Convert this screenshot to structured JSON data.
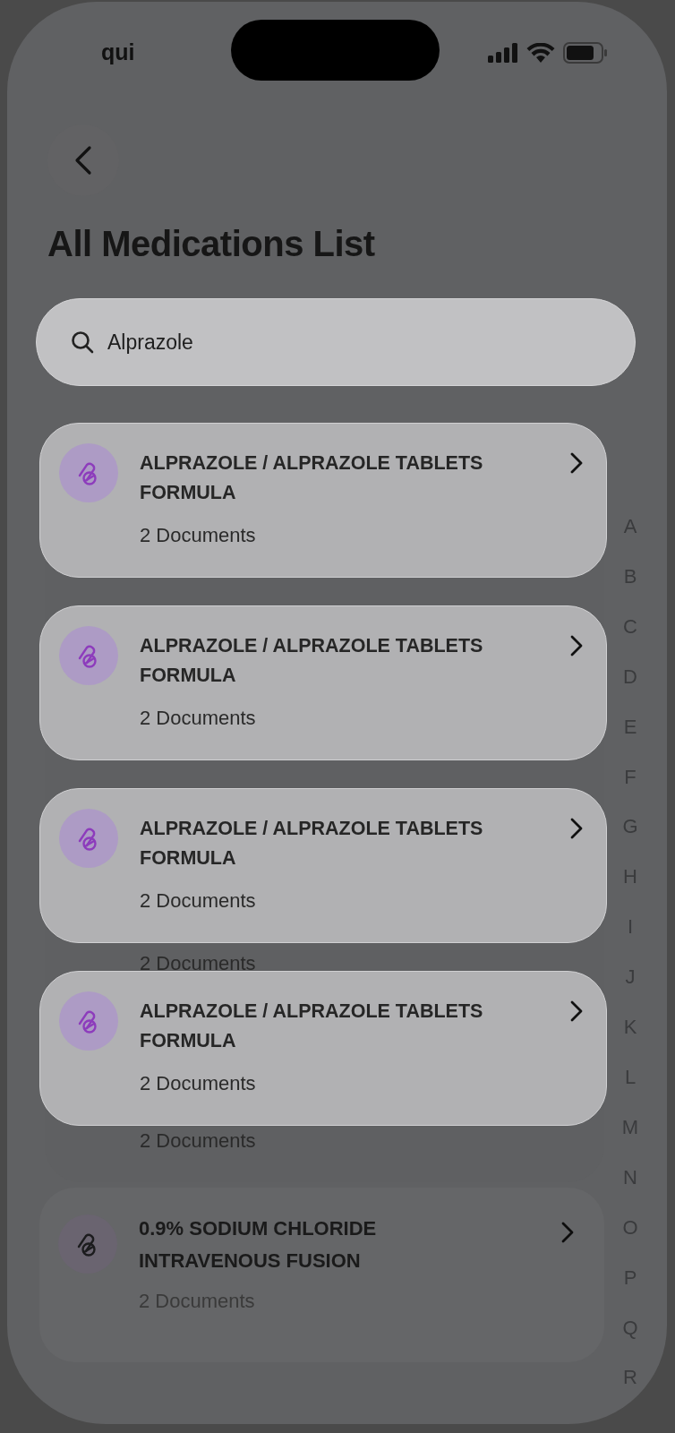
{
  "status_bar": {
    "carrier": "qui"
  },
  "title": "All Medications List",
  "search": {
    "value": "Alprazole"
  },
  "alphabet_index": [
    "A",
    "B",
    "C",
    "D",
    "E",
    "F",
    "G",
    "H",
    "I",
    "J",
    "K",
    "L",
    "M",
    "N",
    "O",
    "P",
    "Q",
    "R"
  ],
  "background_rows": [
    {
      "documents": "2 Documents"
    },
    {
      "documents": "2 Documents"
    }
  ],
  "background_cards": [
    {
      "title": "0.9% SODIUM CHLORIDE INTRAVENOUS FUSION",
      "documents": "2 Documents"
    }
  ],
  "results": [
    {
      "title": "ALPRAZOLE / ALPRAZOLE TABLETS FORMULA",
      "documents": "2 Documents"
    },
    {
      "title": "ALPRAZOLE / ALPRAZOLE TABLETS FORMULA",
      "documents": "2 Documents"
    },
    {
      "title": "ALPRAZOLE / ALPRAZOLE TABLETS FORMULA",
      "documents": "2 Documents"
    },
    {
      "title": "ALPRAZOLE / ALPRAZOLE TABLETS FORMULA",
      "documents": "2 Documents"
    }
  ]
}
